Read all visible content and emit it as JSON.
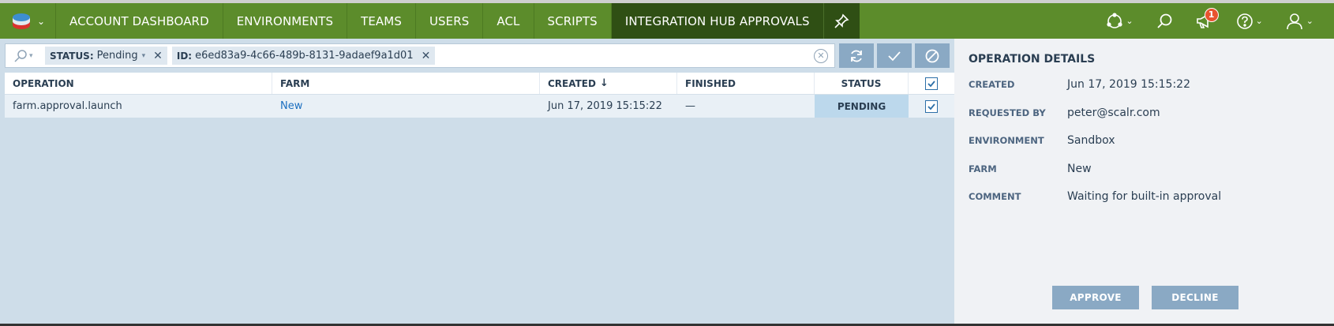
{
  "nav": {
    "tabs": [
      {
        "label": "ACCOUNT DASHBOARD"
      },
      {
        "label": "ENVIRONMENTS"
      },
      {
        "label": "TEAMS"
      },
      {
        "label": "USERS"
      },
      {
        "label": "ACL"
      },
      {
        "label": "SCRIPTS"
      },
      {
        "label": "INTEGRATION HUB APPROVALS",
        "active": true
      }
    ],
    "notification_count": "1"
  },
  "filter": {
    "chips": [
      {
        "key": "STATUS:",
        "value": "Pending"
      },
      {
        "key": "ID:",
        "value": "e6ed83a9-4c66-489b-8131-9adaef9a1d01"
      }
    ]
  },
  "grid": {
    "columns": [
      "OPERATION",
      "FARM",
      "CREATED",
      "FINISHED",
      "STATUS"
    ],
    "rows": [
      {
        "operation": "farm.approval.launch",
        "farm": "New",
        "created": "Jun 17, 2019 15:15:22",
        "finished": "—",
        "status": "PENDING"
      }
    ]
  },
  "details": {
    "title": "OPERATION DETAILS",
    "fields": [
      {
        "label": "CREATED",
        "value": "Jun 17, 2019 15:15:22"
      },
      {
        "label": "REQUESTED BY",
        "value": "peter@scalr.com"
      },
      {
        "label": "ENVIRONMENT",
        "value": "Sandbox"
      },
      {
        "label": "FARM",
        "value": "New"
      },
      {
        "label": "COMMENT",
        "value": "Waiting for built-in approval"
      }
    ],
    "approve_label": "APPROVE",
    "decline_label": "DECLINE"
  },
  "colors": {
    "topbar": "#5c8c2b",
    "active_tab": "#2f4f14",
    "pending_cell": "#bcd8ec",
    "action_button": "#8aa9c4",
    "link": "#1c6fc0",
    "badge": "#e8542f"
  },
  "icons": [
    "scalr-logo-icon",
    "pin-icon",
    "cycle-icon",
    "search-icon",
    "megaphone-icon",
    "help-icon",
    "user-icon",
    "refresh-icon",
    "approve-check-icon",
    "decline-cancel-icon",
    "clear-search-icon",
    "sort-desc-icon",
    "checkbox-icon"
  ]
}
